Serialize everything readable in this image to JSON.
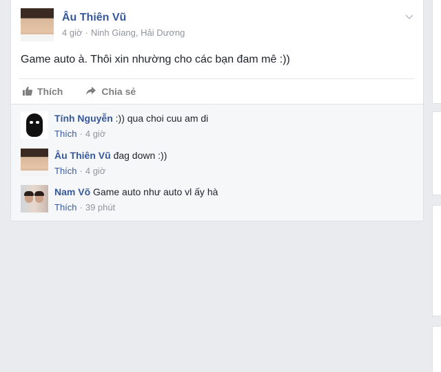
{
  "post": {
    "author": "Âu Thiên Vũ",
    "time": "4 giờ",
    "separator": "·",
    "location": "Ninh Giang, Hải Dương",
    "text": "Game auto à. Thôi xin nhường cho các bạn đam mê :))",
    "actions": {
      "like_label": "Thích",
      "share_label": "Chia sẻ"
    }
  },
  "comments": [
    {
      "author": "Tính Nguyễn",
      "text": ":)) qua choi cuu am di",
      "like_label": "Thích",
      "time": "4 giờ"
    },
    {
      "author": "Âu Thiên Vũ",
      "text": "đag down :))",
      "like_label": "Thích",
      "time": "4 giờ"
    },
    {
      "author": "Nam Võ",
      "text": "Game auto như auto vl ấy hà",
      "like_label": "Thích",
      "time": "39 phút"
    }
  ],
  "colors": {
    "link_blue": "#365899",
    "meta_gray": "#90949c",
    "page_bg": "#e9ebee"
  },
  "icons": {
    "options": "chevron-down-icon",
    "like": "thumbs-up-icon",
    "share": "share-arrow-icon"
  }
}
